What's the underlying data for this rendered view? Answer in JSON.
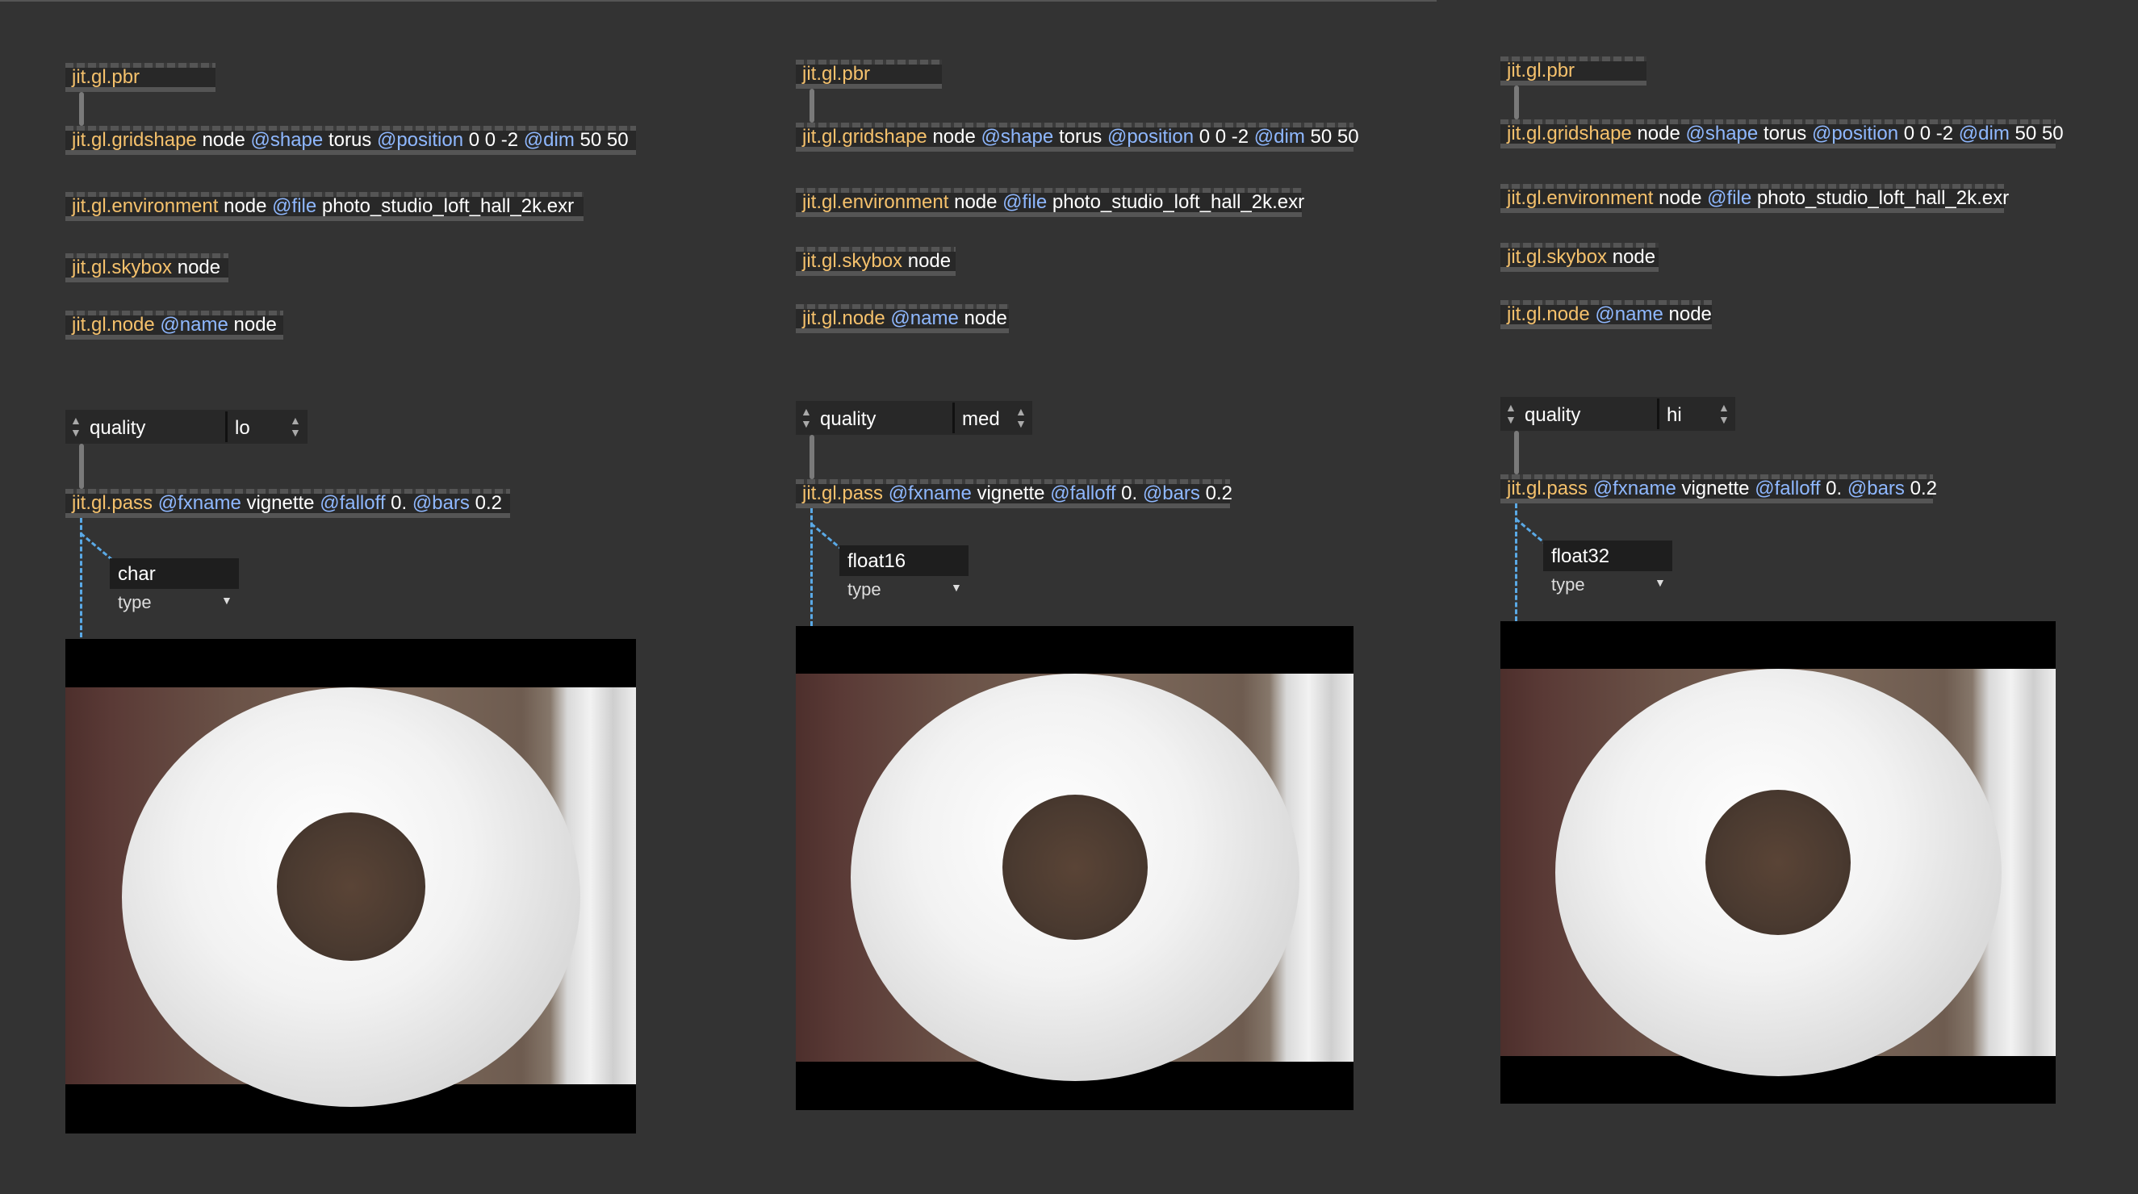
{
  "objects": {
    "pbr": "jit.gl.pbr",
    "gridshape": {
      "cls": "jit.gl.gridshape",
      "arg1": "node",
      "att1": "@shape",
      "arg2": "torus",
      "att2": "@position",
      "arg3": "0 0 -2",
      "att3": "@dim",
      "arg4": "50 50"
    },
    "environment": {
      "cls": "jit.gl.environment",
      "arg1": "node",
      "att1": "@file",
      "arg2": "photo_studio_loft_hall_2k.exr"
    },
    "skybox": {
      "cls": "jit.gl.skybox",
      "arg1": "node"
    },
    "node": {
      "cls": "jit.gl.node",
      "att1": "@name",
      "arg1": "node"
    },
    "pass": {
      "cls": "jit.gl.pass",
      "att1": "@fxname",
      "arg1": "vignette",
      "att2": "@falloff",
      "arg2": "0.",
      "att3": "@bars",
      "arg3": "0.2"
    },
    "quality_label": "quality",
    "type_label": "type"
  },
  "columns": [
    {
      "quality_value": "lo",
      "type_value": "char"
    },
    {
      "quality_value": "med",
      "type_value": "float16"
    },
    {
      "quality_value": "hi",
      "type_value": "float32"
    }
  ],
  "icons": {
    "umenu_arrows": "up-down-arrows-icon",
    "dropdown": "caret-down-icon"
  },
  "colors": {
    "background": "#333333",
    "object_class": "#f5c16c",
    "attribute": "#8fb8ff",
    "patch_cord_dashed": "#5aa9e6"
  }
}
